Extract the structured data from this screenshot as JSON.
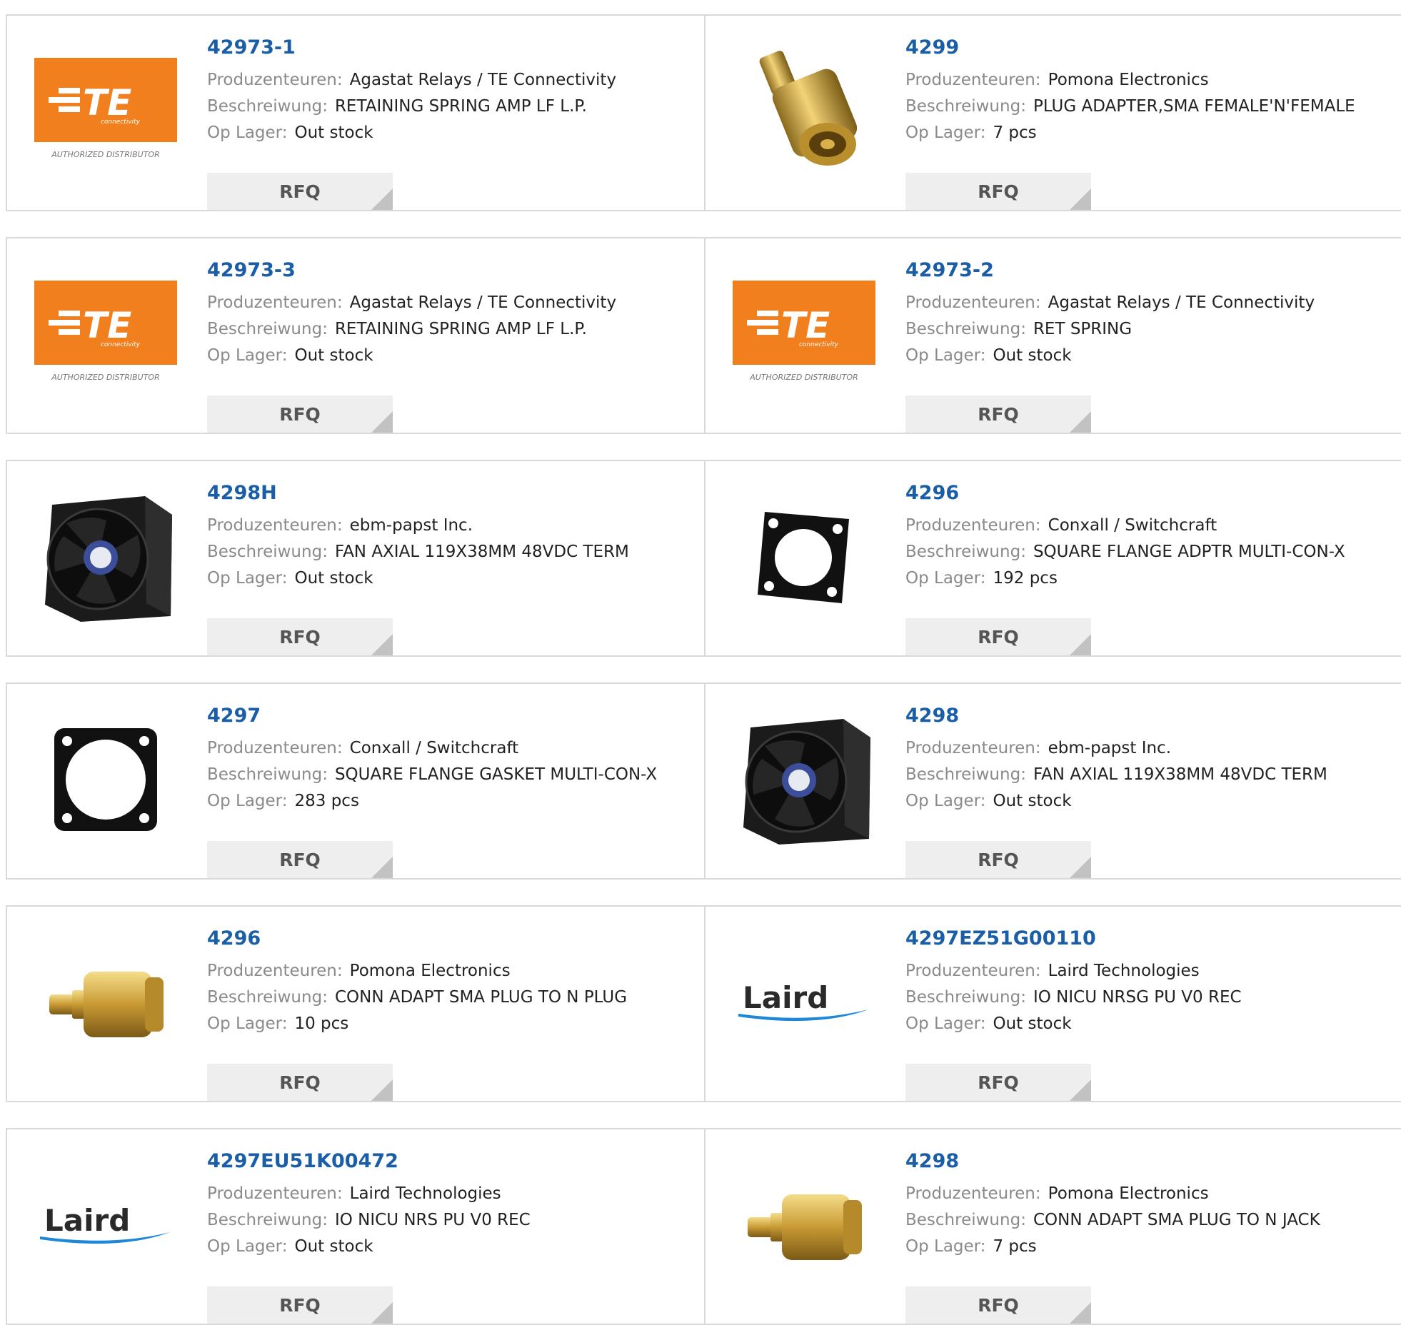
{
  "labels": {
    "manufacturer": "Produzenteuren:",
    "description": "Beschreiwung:",
    "stock": "Op Lager:",
    "rfq": "RFQ"
  },
  "brand_colors": {
    "te_orange": "#f27f1d",
    "part_link": "#1a5ea8",
    "laird_blue": "#1e88d8"
  },
  "logo_text": {
    "te": "TE",
    "te_sub": "connectivity",
    "te_authorized": "AUTHORIZED DISTRIBUTOR",
    "laird": "Laird"
  },
  "products": [
    {
      "part": "42973-1",
      "manufacturer": "Agastat Relays / TE Connectivity",
      "description": "RETAINING SPRING AMP LF L.P.",
      "stock": "Out stock",
      "image": "te-logo"
    },
    {
      "part": "4299",
      "manufacturer": "Pomona Electronics",
      "description": "PLUG ADAPTER,SMA FEMALE'N'FEMALE",
      "stock": "7 pcs",
      "image": "sma-n-adapter"
    },
    {
      "part": "42973-3",
      "manufacturer": "Agastat Relays / TE Connectivity",
      "description": "RETAINING SPRING AMP LF L.P.",
      "stock": "Out stock",
      "image": "te-logo"
    },
    {
      "part": "42973-2",
      "manufacturer": "Agastat Relays / TE Connectivity",
      "description": "RET SPRING",
      "stock": "Out stock",
      "image": "te-logo"
    },
    {
      "part": "4298H",
      "manufacturer": "ebm-papst Inc.",
      "description": "FAN AXIAL 119X38MM 48VDC TERM",
      "stock": "Out stock",
      "image": "axial-fan"
    },
    {
      "part": "4296",
      "manufacturer": "Conxall / Switchcraft",
      "description": "SQUARE FLANGE ADPTR MULTI-CON-X",
      "stock": "192 pcs",
      "image": "square-flange"
    },
    {
      "part": "4297",
      "manufacturer": "Conxall / Switchcraft",
      "description": "SQUARE FLANGE GASKET MULTI-CON-X",
      "stock": "283 pcs",
      "image": "flange-gasket"
    },
    {
      "part": "4298",
      "manufacturer": "ebm-papst Inc.",
      "description": "FAN AXIAL 119X38MM 48VDC TERM",
      "stock": "Out stock",
      "image": "axial-fan"
    },
    {
      "part": "4296",
      "manufacturer": "Pomona Electronics",
      "description": "CONN ADAPT SMA PLUG TO N PLUG",
      "stock": "10 pcs",
      "image": "sma-n-adapter-side"
    },
    {
      "part": "4297EZ51G00110",
      "manufacturer": "Laird Technologies",
      "description": "IO NICU NRSG PU V0 REC",
      "stock": "Out stock",
      "image": "laird-logo"
    },
    {
      "part": "4297EU51K00472",
      "manufacturer": "Laird Technologies",
      "description": "IO NICU NRS PU V0 REC",
      "stock": "Out stock",
      "image": "laird-logo"
    },
    {
      "part": "4298",
      "manufacturer": "Pomona Electronics",
      "description": "CONN ADAPT SMA PLUG TO N JACK",
      "stock": "7 pcs",
      "image": "sma-n-adapter-side"
    }
  ]
}
